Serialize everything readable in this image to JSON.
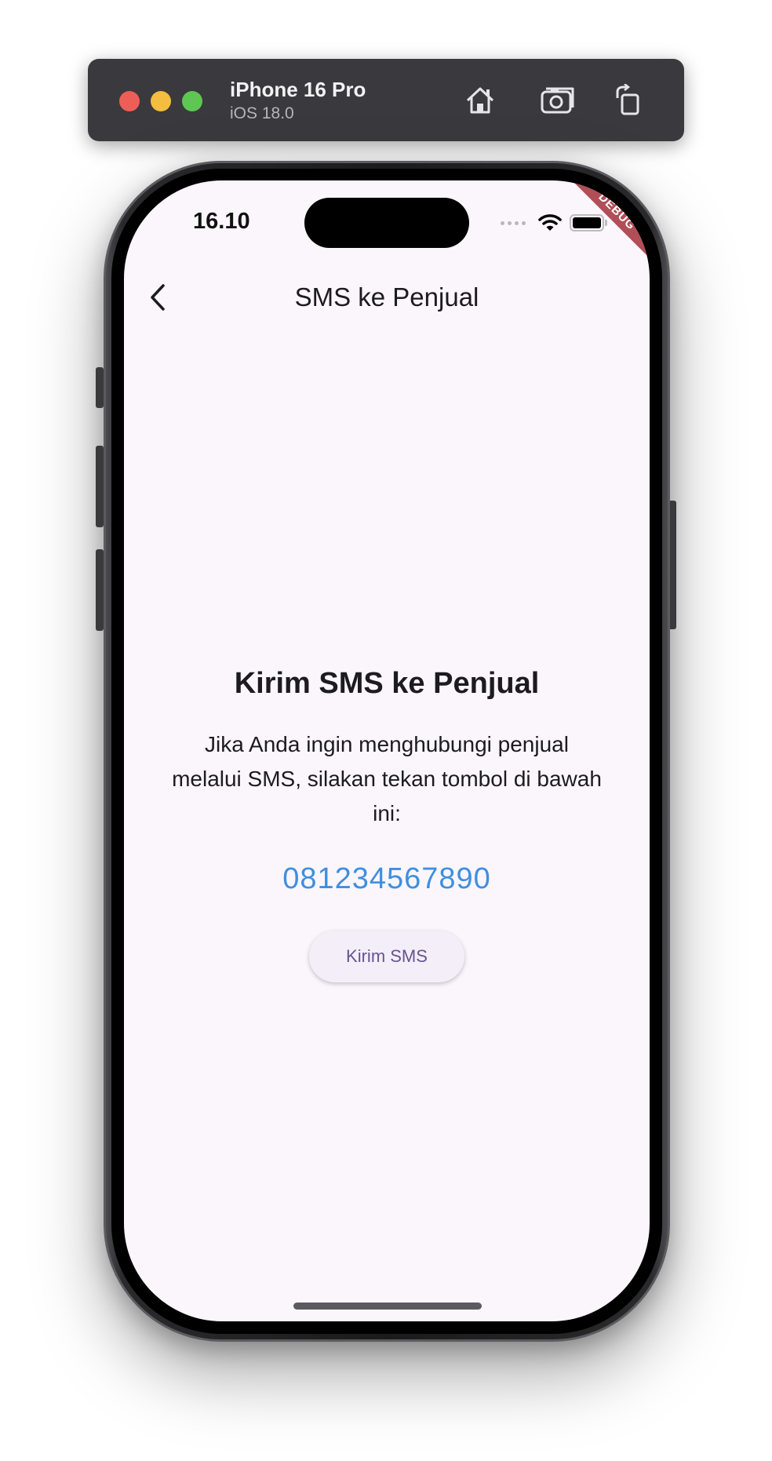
{
  "simulator": {
    "device_name": "iPhone 16 Pro",
    "os_version": "iOS 18.0",
    "buttons": [
      "home-icon",
      "screenshot-icon",
      "rotate-icon"
    ]
  },
  "status_bar": {
    "time": "16.10",
    "icons": [
      "cellular-signal-icon",
      "wifi-icon",
      "battery-icon"
    ]
  },
  "debug_banner": "DEBUG",
  "app_bar": {
    "title": "SMS ke Penjual",
    "back_icon": "chevron-left-icon"
  },
  "content": {
    "headline": "Kirim SMS ke Penjual",
    "description": "Jika Anda ingin menghubungi penjual melalui SMS, silakan tekan tombol di bawah ini:",
    "phone_number": "081234567890",
    "button_label": "Kirim SMS"
  },
  "colors": {
    "background": "#fbf6fc",
    "phone_number": "#3f8fe0",
    "button_text": "#65558f",
    "button_bg": "#f4eef9"
  }
}
